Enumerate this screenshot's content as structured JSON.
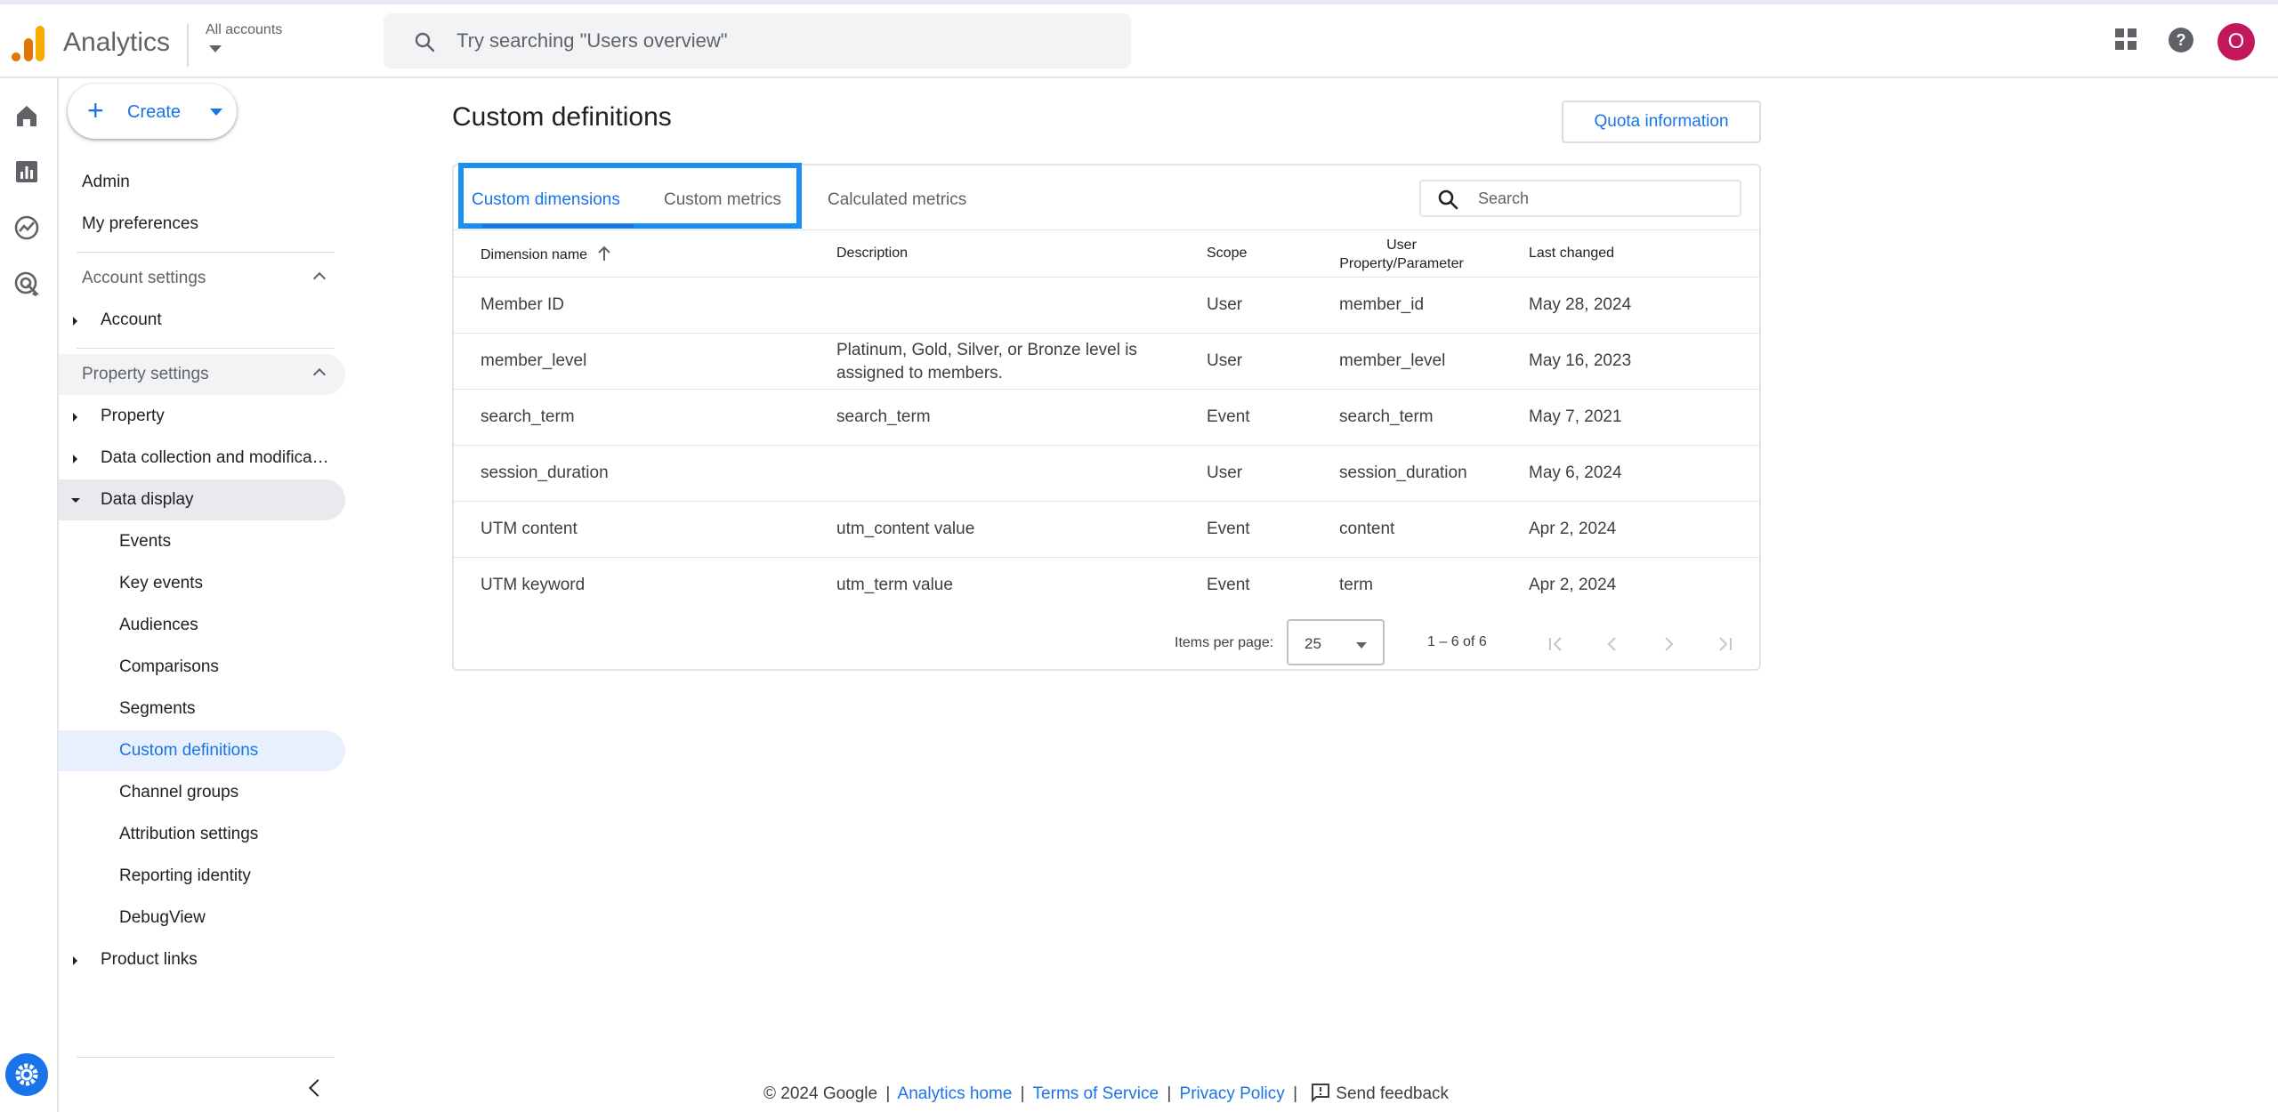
{
  "header": {
    "app_name": "Analytics",
    "account_label": "All accounts",
    "search_placeholder": "Try searching \"Users overview\"",
    "avatar_letter": "O"
  },
  "nav": {
    "create_label": "Create",
    "admin": "Admin",
    "my_preferences": "My preferences",
    "account_settings": "Account settings",
    "account": "Account",
    "property_settings": "Property settings",
    "property": "Property",
    "data_collection": "Data collection and modifica…",
    "data_display": "Data display",
    "sub_items": [
      "Events",
      "Key events",
      "Audiences",
      "Comparisons",
      "Segments",
      "Custom definitions",
      "Channel groups",
      "Attribution settings",
      "Reporting identity",
      "DebugView"
    ],
    "product_links": "Product links"
  },
  "main": {
    "title": "Custom definitions",
    "quota_button": "Quota information",
    "tabs": [
      "Custom dimensions",
      "Custom metrics",
      "Calculated metrics"
    ],
    "search_placeholder": "Search",
    "columns": {
      "name": "Dimension name",
      "description": "Description",
      "scope": "Scope",
      "param_line1": "User",
      "param_line2": "Property/Parameter",
      "last_changed": "Last changed"
    },
    "rows": [
      {
        "name": "Member ID",
        "description": "",
        "scope": "User",
        "param": "member_id",
        "changed": "May 28, 2024"
      },
      {
        "name": "member_level",
        "description": "Platinum, Gold, Silver, or Bronze level is assigned to members.",
        "scope": "User",
        "param": "member_level",
        "changed": "May 16, 2023"
      },
      {
        "name": "search_term",
        "description": "search_term",
        "scope": "Event",
        "param": "search_term",
        "changed": "May 7, 2021"
      },
      {
        "name": "session_duration",
        "description": "",
        "scope": "User",
        "param": "session_duration",
        "changed": "May 6, 2024"
      },
      {
        "name": "UTM content",
        "description": "utm_content value",
        "scope": "Event",
        "param": "content",
        "changed": "Apr 2, 2024"
      },
      {
        "name": "UTM keyword",
        "description": "utm_term value",
        "scope": "Event",
        "param": "term",
        "changed": "Apr 2, 2024"
      }
    ],
    "pager": {
      "items_label": "Items per page:",
      "per_page": "25",
      "range": "1 – 6 of 6"
    }
  },
  "footer": {
    "copyright": "© 2024 Google",
    "analytics_home": "Analytics home",
    "terms": "Terms of Service",
    "privacy": "Privacy Policy",
    "feedback": "Send feedback",
    "separator": "|"
  },
  "colors": {
    "accent": "#1a73e8",
    "highlight": "#1a8ff2",
    "avatar": "#c2185b"
  }
}
